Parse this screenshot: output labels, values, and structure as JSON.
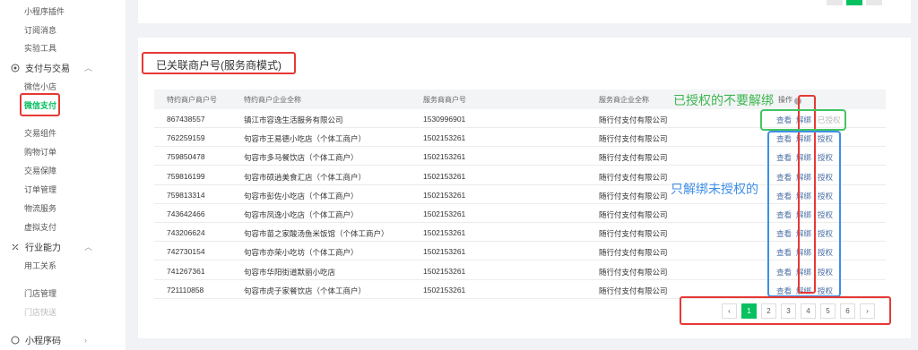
{
  "sidebar": {
    "items_top": [
      "小程序插件",
      "订阅消息",
      "实验工具"
    ],
    "group_payment": "支付与交易",
    "items_payment": [
      "微信小店",
      "微信支付",
      "交易组件",
      "购物订单",
      "交易保障",
      "订单管理",
      "物流服务",
      "虚拟支付"
    ],
    "group_industry": "行业能力",
    "items_industry": [
      "用工关系",
      "门店管理",
      "门店快送"
    ],
    "group_code": "小程序码"
  },
  "section": {
    "title": "已关联商户号(服务商模式)"
  },
  "table": {
    "headers": [
      "特约商户商户号",
      "特约商户企业全称",
      "服务商商户号",
      "服务商企业全称",
      "操作"
    ],
    "rows": [
      {
        "merchant_id": "867438557",
        "merchant_name": "镇江市容逸生活服务有限公司",
        "sp_id": "1530996901",
        "sp_name": "随行付支付有限公司",
        "auth": "已授权"
      },
      {
        "merchant_id": "762259159",
        "merchant_name": "句容市王易德小吃店（个体工商户）",
        "sp_id": "1502153261",
        "sp_name": "随行付支付有限公司",
        "auth": "授权"
      },
      {
        "merchant_id": "759850478",
        "merchant_name": "句容市多马餐饮店（个体工商户）",
        "sp_id": "1502153261",
        "sp_name": "随行付支付有限公司",
        "auth": "授权"
      },
      {
        "merchant_id": "759816199",
        "merchant_name": "句容市硕逍美食汇店（个体工商户）",
        "sp_id": "1502153261",
        "sp_name": "随行付支付有限公司",
        "auth": "授权"
      },
      {
        "merchant_id": "759813314",
        "merchant_name": "句容市彭佐小吃店（个体工商户）",
        "sp_id": "1502153261",
        "sp_name": "随行付支付有限公司",
        "auth": "授权"
      },
      {
        "merchant_id": "743642466",
        "merchant_name": "句容市凤逸小吃店（个体工商户）",
        "sp_id": "1502153261",
        "sp_name": "随行付支付有限公司",
        "auth": "授权"
      },
      {
        "merchant_id": "743206624",
        "merchant_name": "句容市苗之家酸汤鱼米饭馆（个体工商户）",
        "sp_id": "1502153261",
        "sp_name": "随行付支付有限公司",
        "auth": "授权"
      },
      {
        "merchant_id": "742730154",
        "merchant_name": "句容市亦荣小吃坊（个体工商户）",
        "sp_id": "1502153261",
        "sp_name": "随行付支付有限公司",
        "auth": "授权"
      },
      {
        "merchant_id": "741267361",
        "merchant_name": "句容市华阳街道默丽小吃店",
        "sp_id": "1502153261",
        "sp_name": "随行付支付有限公司",
        "auth": "授权"
      },
      {
        "merchant_id": "721110858",
        "merchant_name": "句容市虎子家餐饮店（个体工商户）",
        "sp_id": "1502153261",
        "sp_name": "随行付支付有限公司",
        "auth": "授权"
      }
    ],
    "view_label": "查看",
    "unbind_label": "解绑"
  },
  "annotations": {
    "green_note": "已授权的不要解绑",
    "blue_note": "只解绑未授权的"
  },
  "pagination": {
    "prev": "‹",
    "pages": [
      "1",
      "2",
      "3",
      "4",
      "5",
      "6"
    ],
    "next": "›",
    "current": "1"
  },
  "colors": {
    "accent": "#07c160",
    "red_box": "#e53935",
    "green_box": "#43c463",
    "blue_box": "#3f8ee8"
  }
}
